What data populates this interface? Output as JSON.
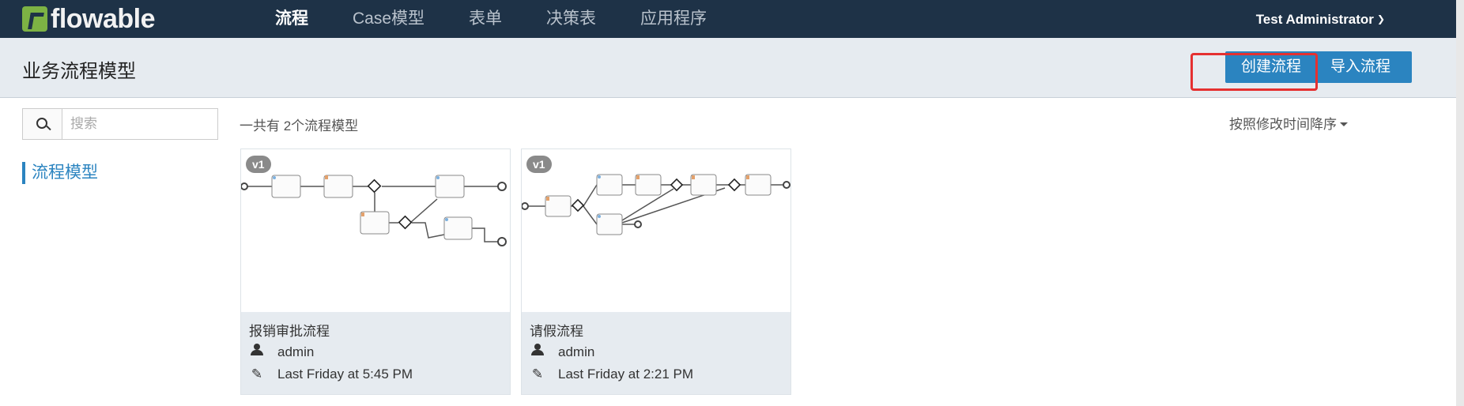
{
  "navbar": {
    "logo_text": "flowable",
    "items": [
      {
        "label": "流程",
        "active": true
      },
      {
        "label": "Case模型",
        "active": false
      },
      {
        "label": "表单",
        "active": false
      },
      {
        "label": "决策表",
        "active": false
      },
      {
        "label": "应用程序",
        "active": false
      }
    ],
    "user_name": "Test Administrator",
    "user_chevron": "chevron-down-icon"
  },
  "subheader": {
    "title": "业务流程模型",
    "create_button": "创建流程",
    "import_button": "导入流程"
  },
  "sidebar": {
    "search_placeholder": "搜索",
    "items": [
      {
        "label": "流程模型",
        "active": true
      }
    ]
  },
  "main": {
    "count_text": "一共有 2个流程模型",
    "sort_label": "按照修改时间降序",
    "models": [
      {
        "version": "v1",
        "name": "报销审批流程",
        "user": "admin",
        "modified": "Last Friday at 5:45 PM"
      },
      {
        "version": "v1",
        "name": "请假流程",
        "user": "admin",
        "modified": "Last Friday at 2:21 PM"
      }
    ]
  },
  "colors": {
    "navbar": "#1e3247",
    "accent": "#2b84c0",
    "subheader": "#e6ebf0",
    "highlight": "#e53030"
  }
}
